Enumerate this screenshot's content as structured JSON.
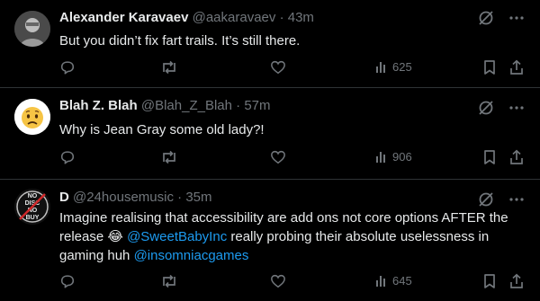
{
  "tweets": [
    {
      "name": "Alexander Karavaev",
      "handle": "@aakaravaev",
      "separator": "·",
      "time": "43m",
      "text": "But you didn’t fix fart trails. It’s still there.",
      "views": "625",
      "avatar": "person-photo"
    },
    {
      "name": "Blah Z. Blah",
      "handle": "@Blah_Z_Blah",
      "separator": "·",
      "time": "57m",
      "text": "Why is Jean Gray some old lady?!",
      "views": "906",
      "avatar": "worried-emoji",
      "avatar_color": "#f6c445"
    },
    {
      "name": "D",
      "handle": "@24housemusic",
      "separator": "·",
      "time": "35m",
      "text_part1": "Imagine realising that accessibility are add ons not core options AFTER the release ",
      "emoji": "😂",
      "mention1": "@SweetBabyInc",
      "text_part2": " really probing their absolute uselessness in gaming huh ",
      "mention2": "@insomniacgames",
      "views": "645",
      "avatar_text": [
        "NO",
        "DISC",
        "NO",
        "BUY"
      ]
    }
  ],
  "colors": {
    "background": "#000000",
    "text": "#e7e9ea",
    "muted": "#71767b",
    "link": "#1d9bf0",
    "divider": "#2f3336"
  }
}
